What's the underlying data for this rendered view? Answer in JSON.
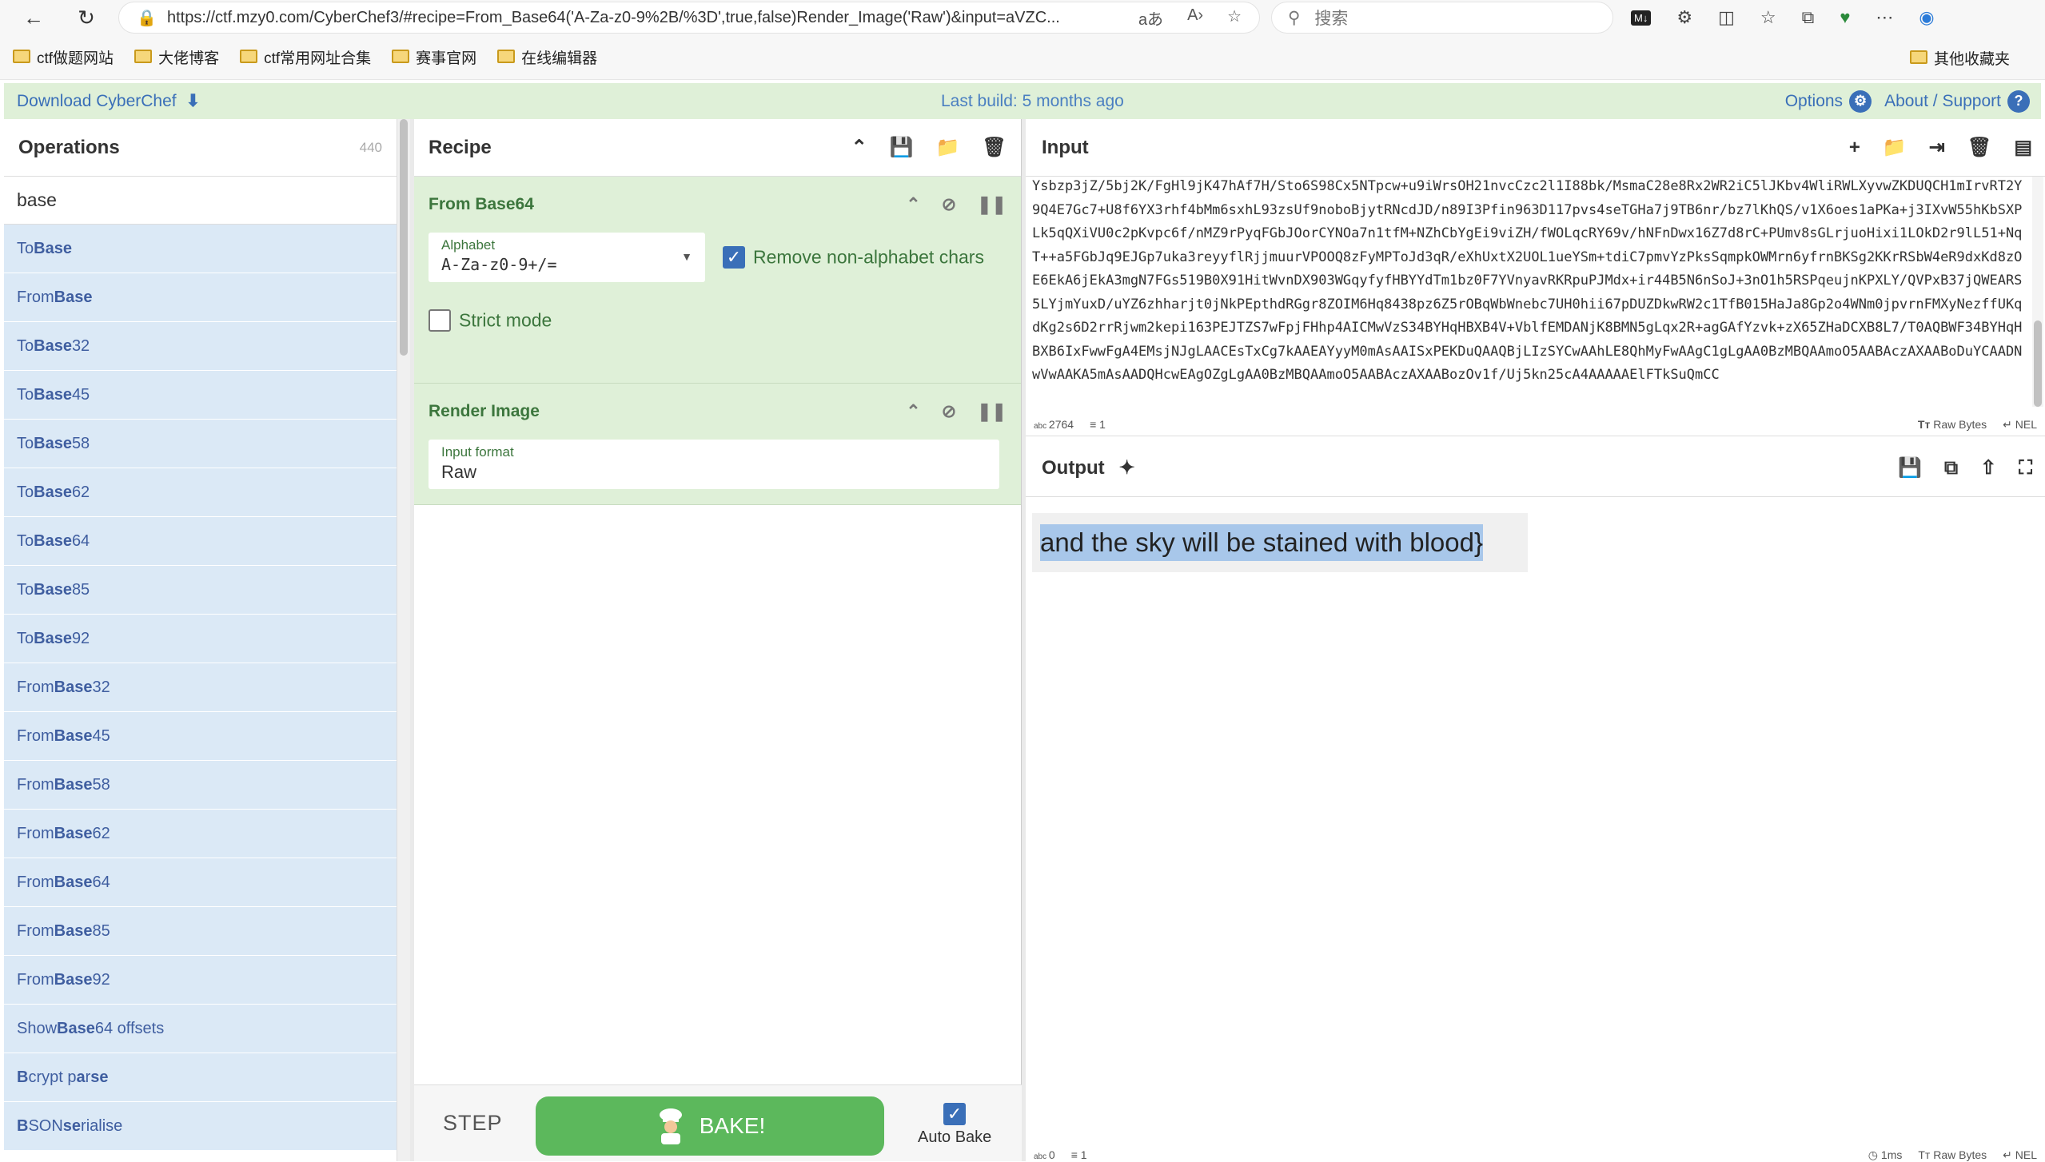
{
  "browser": {
    "url": "https://ctf.mzy0.com/CyberChef3/#recipe=From_Base64('A-Za-z0-9%2B/%3D',true,false)Render_Image('Raw')&input=aVZC...",
    "search_placeholder": "搜索",
    "bookmarks": [
      "ctf做题网站",
      "大佬博客",
      "ctf常用网址合集",
      "赛事官网",
      "在线编辑器"
    ],
    "other_bookmarks": "其他收藏夹"
  },
  "banner": {
    "download": "Download CyberChef",
    "last_build": "Last build: 5 months ago",
    "options": "Options",
    "about": "About / Support"
  },
  "operations": {
    "title": "Operations",
    "count": "440",
    "search_value": "base",
    "items": [
      {
        "pre": "To ",
        "bold": "Base",
        "post": ""
      },
      {
        "pre": "From ",
        "bold": "Base",
        "post": ""
      },
      {
        "pre": "To ",
        "bold": "Base",
        "post": "32"
      },
      {
        "pre": "To ",
        "bold": "Base",
        "post": "45"
      },
      {
        "pre": "To ",
        "bold": "Base",
        "post": "58"
      },
      {
        "pre": "To ",
        "bold": "Base",
        "post": "62"
      },
      {
        "pre": "To ",
        "bold": "Base",
        "post": "64"
      },
      {
        "pre": "To ",
        "bold": "Base",
        "post": "85"
      },
      {
        "pre": "To ",
        "bold": "Base",
        "post": "92"
      },
      {
        "pre": "From ",
        "bold": "Base",
        "post": "32"
      },
      {
        "pre": "From ",
        "bold": "Base",
        "post": "45"
      },
      {
        "pre": "From ",
        "bold": "Base",
        "post": "58"
      },
      {
        "pre": "From ",
        "bold": "Base",
        "post": "62"
      },
      {
        "pre": "From ",
        "bold": "Base",
        "post": "64"
      },
      {
        "pre": "From ",
        "bold": "Base",
        "post": "85"
      },
      {
        "pre": "From ",
        "bold": "Base",
        "post": "92"
      },
      {
        "pre": "Show ",
        "bold": "Base",
        "post": "64 offsets"
      },
      {
        "pre": "",
        "bold": "B",
        "post": "crypt p",
        "bold2": "a",
        "post2": "r",
        "bold3": "se",
        "post3": ""
      },
      {
        "pre": "",
        "bold": "B",
        "post": "SON ",
        "bold2": "se",
        "post2": "rialise",
        "bold3": "",
        "post3": ""
      }
    ]
  },
  "recipe": {
    "title": "Recipe",
    "from_base64": {
      "title": "From Base64",
      "alphabet_label": "Alphabet",
      "alphabet_value": "A-Za-z0-9+/=",
      "remove_label": "Remove non-alphabet chars",
      "remove_checked": true,
      "strict_label": "Strict mode",
      "strict_checked": false
    },
    "render_image": {
      "title": "Render Image",
      "format_label": "Input format",
      "format_value": "Raw"
    },
    "step": "STEP",
    "bake": "BAKE!",
    "auto_bake": "Auto Bake"
  },
  "input": {
    "title": "Input",
    "text": "Ysbzp3jZ/5bj2K/FgHl9jK47hAf7H/Sto6S98Cx5NTpcw+u9iWrsOH21nvcCzc2l1I88bk/MsmaC28e8Rx2WR2iC5lJKbv4WliRWLXyvwZKDUQCH1mIrvRT2Y9Q4E7Gc7+U8f6YX3rhf4bMm6sxhL93zsUf9noboBjytRNcdJD/n89I3Pfin963D117pvs4seTGHa7j9TB6nr/bz7lKhQS/v1X6oes1aPKa+j3IXvW55hKbSXPLk5qQXiVU0c2pKvpc6f/nMZ9rPyqFGbJOorCYNOa7n1tfM+NZhCbYgEi9viZH/fWOLqcRY69v/hNFnDwx16Z7d8rC+PUmv8sGLrjuoHixi1LOkD2r9lL51+NqT++a5FGbJq9EJGp7uka3reyyflRjjmuurVPOOQ8zFyMPToJd3qR/eXhUxtX2UOL1ueYSm+tdiC7pmvYzPksSqmpkOWMrn6yfrnBKSg2KKrRSbW4eR9dxKd8zOE6EkA6jEkA3mgN7FGs519B0X91HitWvnDX903WGqyfyfHBYYdTm1bz0F7YVnyavRKRpuPJMdx+ir44B5N6nSoJ+3nO1h5RSPqeujnKPXLY/QVPxB37jQWEARS5LYjmYuxD/uYZ6zhharjt0jNkPEpthdRGgr8ZOIM6Hq8438pz6Z5rOBqWbWnebc7UH0hii67pDUZDkwRW2c1TfB015HaJa8Gp2o4WNm0jpvrnFMXyNezffUKqdKg2s6D2rrRjwm2kepi163PEJTZS7wFpjFHhp4AICMwVzS34BYHqHBXB4V+VblfEMDANjK8BMN5gLqx2R+agGAfYzvk+zX65ZHaDCXB8L7/T0AQBWF34BYHqHBXB6IxFwwFgA4EMsjNJgLAACEsTxCg7kAAEAYyyM0mAsAAISxPEKDuQAAQBjLIzSYCwAAhLE8QhMyFwAAgC1gLgAA0BzMBQAAmoO5AABAczAXAABoDuYCAADNwVwAAKA5mAsAADQHcwEAgOZgLgAA0BzMBQAAmoO5AABAczAXAABozOv1f/Uj5kn25cA4AAAAAElFTkSuQmCC",
    "length": "2764",
    "lines": "1",
    "encoding": "Raw Bytes",
    "eol": "NEL"
  },
  "output": {
    "title": "Output",
    "image_text": "and the sky will be stained with blood}",
    "length": "0",
    "lines": "1",
    "time": "1ms",
    "encoding": "Raw Bytes",
    "eol": "NEL"
  }
}
